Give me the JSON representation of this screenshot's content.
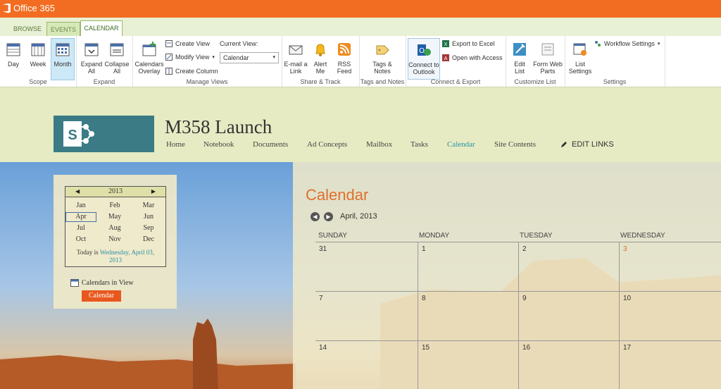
{
  "app": {
    "brand": "Office 365"
  },
  "ribbon_tabs": [
    "BROWSE",
    "EVENTS",
    "CALENDAR"
  ],
  "ribbon": {
    "scope": {
      "label": "Scope",
      "day": "Day",
      "week": "Week",
      "month": "Month"
    },
    "expand": {
      "label": "Expand",
      "expand_all_1": "Expand",
      "expand_all_2": "All",
      "collapse_all_1": "Collapse",
      "collapse_all_2": "All"
    },
    "manage_views": {
      "label": "Manage Views",
      "overlay_1": "Calendars",
      "overlay_2": "Overlay",
      "create_view": "Create View",
      "modify_view": "Modify View",
      "create_column": "Create Column",
      "current_view_label": "Current View:",
      "current_view_value": "Calendar"
    },
    "share_track": {
      "label": "Share & Track",
      "email_1": "E-mail a",
      "email_2": "Link",
      "alert_1": "Alert",
      "alert_2": "Me",
      "rss_1": "RSS",
      "rss_2": "Feed"
    },
    "tags_notes": {
      "label": "Tags and Notes",
      "tags_1": "Tags &",
      "tags_2": "Notes"
    },
    "connect_export": {
      "label": "Connect & Export",
      "outlook_1": "Connect to",
      "outlook_2": "Outlook",
      "excel": "Export to Excel",
      "access": "Open with Access"
    },
    "customize": {
      "label": "Customize List",
      "edit_1": "Edit",
      "edit_2": "List",
      "form_1": "Form Web",
      "form_2": "Parts"
    },
    "settings": {
      "label": "Settings",
      "list_1": "List",
      "list_2": "Settings",
      "workflow": "Workflow Settings"
    }
  },
  "site": {
    "title": "M358 Launch",
    "nav": [
      "Home",
      "Notebook",
      "Documents",
      "Ad Concepts",
      "Mailbox",
      "Tasks",
      "Calendar",
      "Site Contents"
    ],
    "edit_links": "EDIT LINKS"
  },
  "minical": {
    "year": "2013",
    "months": [
      "Jan",
      "Feb",
      "Mar",
      "Apr",
      "May",
      "Jun",
      "Jul",
      "Aug",
      "Sep",
      "Oct",
      "Nov",
      "Dec"
    ],
    "today_prefix": "Today is",
    "today_date_1": "Wednesday, April 03,",
    "today_date_2": "2013"
  },
  "calendars_in_view": {
    "label": "Calendars in View",
    "button": "Calendar"
  },
  "calendar": {
    "title": "Calendar",
    "period": "April, 2013",
    "days": [
      "SUNDAY",
      "MONDAY",
      "TUESDAY",
      "WEDNESDAY"
    ],
    "rows": [
      [
        "31",
        "1",
        "2",
        "3"
      ],
      [
        "7",
        "8",
        "9",
        "10"
      ],
      [
        "14",
        "15",
        "16",
        "17"
      ]
    ]
  },
  "colors": {
    "accent": "#f26d21",
    "ribbon_green": "#9ab86a",
    "today": "#e0702c"
  }
}
